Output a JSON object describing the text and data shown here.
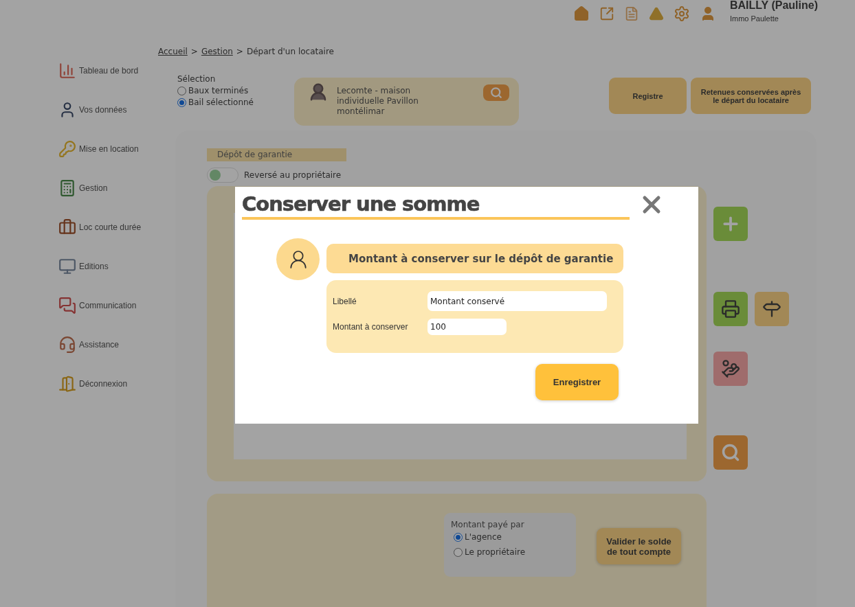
{
  "header": {
    "user_name": "BAILLY (Pauline)",
    "company": "Immo Paulette"
  },
  "sidebar": {
    "items": [
      {
        "label": "Tableau de bord",
        "kind": "dashboard"
      },
      {
        "label": "Vos données",
        "kind": "user"
      },
      {
        "label": "Mise en location",
        "kind": "key"
      },
      {
        "label": "Gestion",
        "kind": "calculator"
      },
      {
        "label": "Loc courte durée",
        "kind": "suitcase"
      },
      {
        "label": "Editions",
        "kind": "monitor"
      },
      {
        "label": "Communication",
        "kind": "chat"
      },
      {
        "label": "Assistance",
        "kind": "headset"
      },
      {
        "label": "Déconnexion",
        "kind": "exit"
      }
    ]
  },
  "breadcrumb": [
    {
      "label": "Accueil",
      "link": true
    },
    {
      "label": ">",
      "link": false
    },
    {
      "label": "Gestion",
      "link": true
    },
    {
      "label": ">",
      "link": false
    },
    {
      "label": "Départ d'un locataire",
      "link": false
    }
  ],
  "selection": {
    "title": "Sélection",
    "options": [
      {
        "label": "Baux terminés",
        "selected": false
      },
      {
        "label": "Bail sélectionné",
        "selected": true
      }
    ]
  },
  "lease_card": {
    "text": "Lecomte - maison individuelle Pavillon montélimar"
  },
  "top_buttons": [
    "Registre",
    "Retenues conservées après le départ du locataire"
  ],
  "deposit": {
    "tab": "Dépôt de garantie",
    "toggle": {
      "label": "Reversé au propriétaire",
      "on": false
    }
  },
  "payment": {
    "title": "Montant payé par",
    "options": [
      {
        "label": "L'agence",
        "selected": true
      },
      {
        "label": "Le propriétaire",
        "selected": false
      }
    ]
  },
  "validate_button": "Valider le solde de tout compte",
  "modal": {
    "title": "Conserver une somme",
    "section_title": "Montant à conserver sur le dépôt de garantie",
    "fields": [
      {
        "label": "Libellé",
        "value": "Montant conservé",
        "kind": "wide"
      },
      {
        "label": "Montant à conserver",
        "value": "100",
        "kind": "narrow"
      }
    ],
    "save_button": "Enregistrer"
  }
}
